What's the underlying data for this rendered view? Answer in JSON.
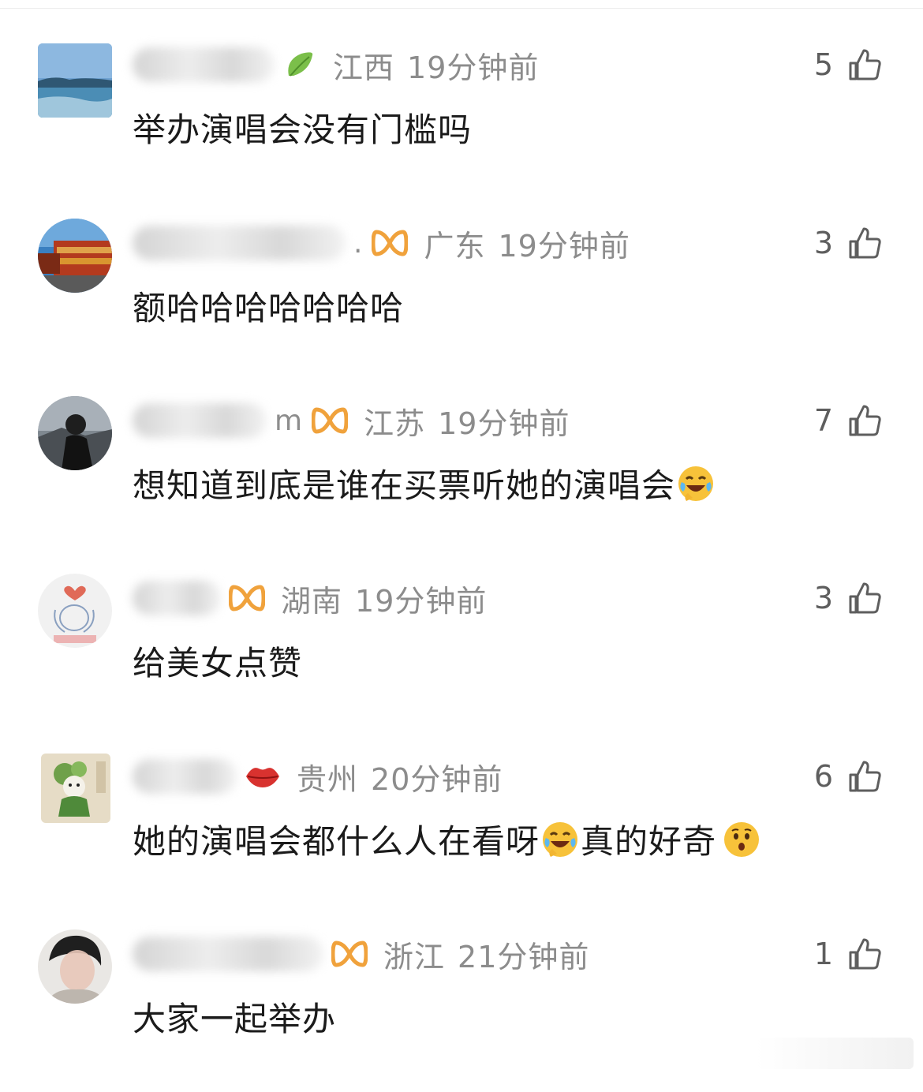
{
  "comments": [
    {
      "name_suffix": "",
      "badge": "leaf",
      "location": "江西",
      "time": "19分钟前",
      "likes": "5",
      "text_parts": [
        "举办演唱会没有门槛吗"
      ],
      "avatar": "sea"
    },
    {
      "name_suffix": ".",
      "badge": "vip",
      "location": "广东",
      "time": "19分钟前",
      "likes": "3",
      "text_parts": [
        "额哈哈哈哈哈哈哈"
      ],
      "avatar": "truck"
    },
    {
      "name_suffix": "m",
      "badge": "vip",
      "location": "江苏",
      "time": "19分钟前",
      "likes": "7",
      "text_parts": [
        "想知道到底是谁在买票听她的演唱会"
      ],
      "emojis": [
        "laugh-cry"
      ],
      "avatar": "person-dark"
    },
    {
      "name_suffix": "",
      "badge": "vip",
      "location": "湖南",
      "time": "19分钟前",
      "likes": "3",
      "text_parts": [
        "给美女点赞"
      ],
      "avatar": "heart-hands"
    },
    {
      "name_suffix": "",
      "badge": "lips",
      "location": "贵州",
      "time": "20分钟前",
      "likes": "6",
      "text_parts": [
        "她的演唱会都什么人在看呀",
        "真的好奇"
      ],
      "emojis": [
        "laugh-cry",
        "surprised"
      ],
      "avatar": "dog-flowers"
    },
    {
      "name_suffix": "",
      "badge": "vip",
      "location": "浙江",
      "time": "21分钟前",
      "likes": "1",
      "text_parts": [
        "大家一起举办"
      ],
      "avatar": "person-blur"
    }
  ],
  "colors": {
    "meta": "#8c8c8c",
    "text": "#1b1b1b",
    "like": "#5e5e5e",
    "vip_badge": "#f0a23c"
  }
}
